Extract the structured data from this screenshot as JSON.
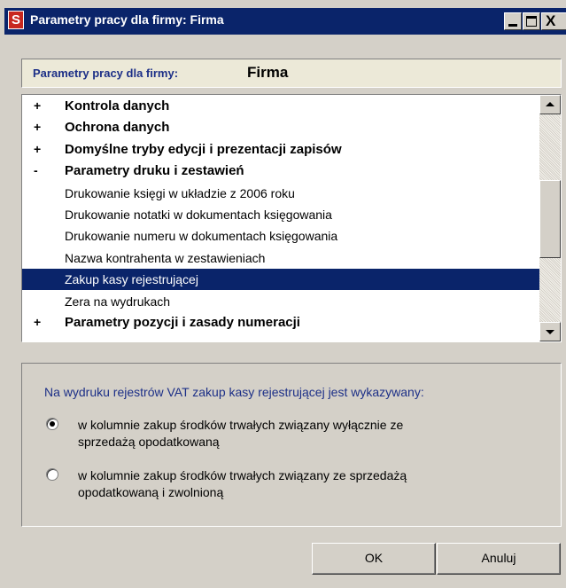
{
  "window": {
    "title": "Parametry pracy dla firmy: Firma",
    "app_icon_letter": "S",
    "close_glyph": "X"
  },
  "header": {
    "label": "Parametry pracy dla firmy:",
    "value": "Firma"
  },
  "tree": {
    "items": [
      {
        "sign": "+",
        "label": "Kontrola danych",
        "type": "group"
      },
      {
        "sign": "+",
        "label": "Ochrona danych",
        "type": "group"
      },
      {
        "sign": "+",
        "label": "Domyślne tryby edycji i prezentacji zapisów",
        "type": "group"
      },
      {
        "sign": "-",
        "label": "Parametry druku i zestawień",
        "type": "group"
      },
      {
        "sign": "",
        "label": "Drukowanie księgi w układzie z 2006 roku",
        "type": "child"
      },
      {
        "sign": "",
        "label": "Drukowanie notatki w dokumentach księgowania",
        "type": "child"
      },
      {
        "sign": "",
        "label": "Drukowanie numeru w dokumentach księgowania",
        "type": "child"
      },
      {
        "sign": "",
        "label": "Nazwa kontrahenta w zestawieniach",
        "type": "child"
      },
      {
        "sign": "",
        "label": "Zakup kasy rejestrującej",
        "type": "child",
        "selected": true
      },
      {
        "sign": "",
        "label": "Zera na wydrukach",
        "type": "child"
      },
      {
        "sign": "+",
        "label": "Parametry pozycji i zasady numeracji",
        "type": "group"
      }
    ]
  },
  "options": {
    "question": "Na wydruku rejestrów VAT zakup kasy rejestrującej jest wykazywany:",
    "radio1": {
      "line1": "w kolumnie zakup środków trwałych związany wyłącznie ze",
      "line2": "sprzedażą opodatkowaną",
      "checked": true
    },
    "radio2": {
      "line1": "w kolumnie zakup środków trwałych związany ze sprzedażą",
      "line2": "opodatkowaną i zwolnioną",
      "checked": false
    }
  },
  "buttons": {
    "ok": "OK",
    "cancel": "Anuluj"
  }
}
